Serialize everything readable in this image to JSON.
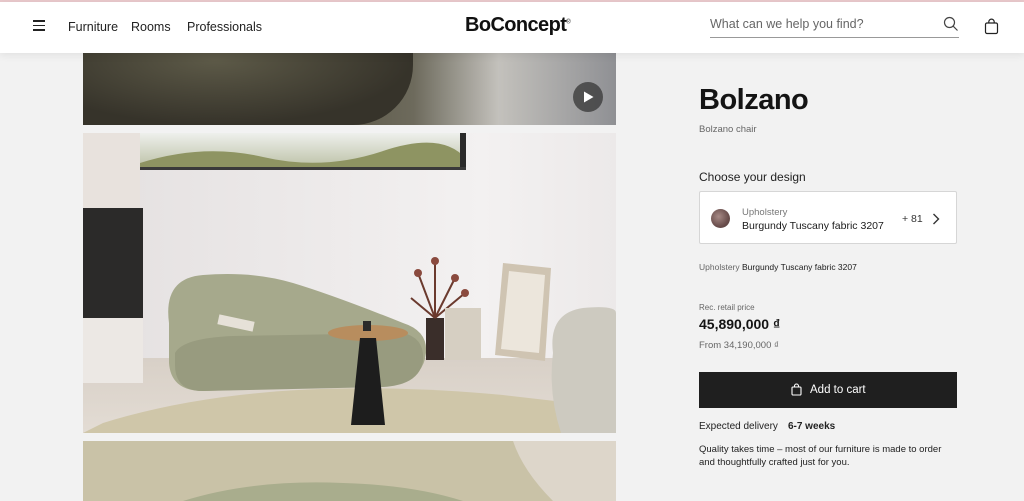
{
  "header": {
    "nav": [
      "Furniture",
      "Rooms",
      "Professionals"
    ],
    "logo": "BoConcept",
    "logo_mark": "®",
    "search_placeholder": "What can we help you find?"
  },
  "product": {
    "name": "Bolzano",
    "subtitle": "Bolzano chair",
    "choose_label": "Choose your design",
    "design": {
      "label": "Upholstery",
      "value": "Burgundy Tuscany fabric 3207",
      "more_count": "+ 81"
    },
    "summary_label": "Upholstery",
    "summary_value": "Burgundy Tuscany fabric 3207",
    "rec_label": "Rec. retail price",
    "price": "45,890,000 ₫",
    "from_price": "From 34,190,000 ₫",
    "cart_label": "Add to cart",
    "delivery_label": "Expected delivery",
    "delivery_value": "6-7 weeks",
    "quality_text": "Quality takes time – most of our furniture is made to order and thoughtfully crafted just for you."
  },
  "colors": {
    "accent": "#1f1f1f",
    "background": "#f2f2f2",
    "top_line": "#e9c9cc"
  },
  "icons": [
    "hamburger-icon",
    "search-icon",
    "shopping-bag-icon",
    "play-icon",
    "chevron-right-icon",
    "fabric-swatch-icon"
  ]
}
